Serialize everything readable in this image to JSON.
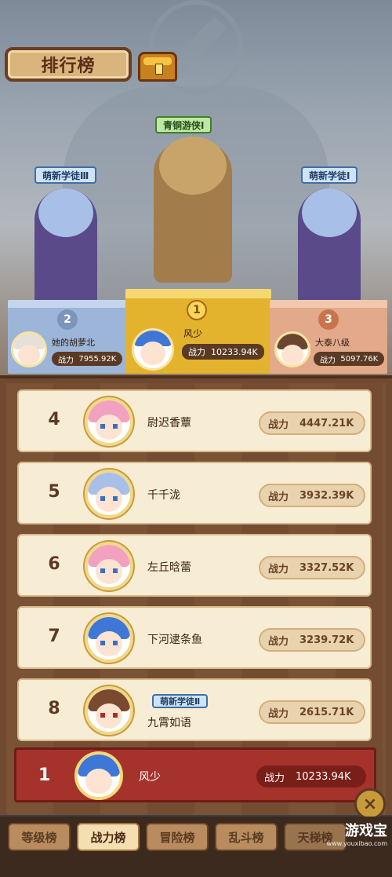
{
  "header": {
    "title": "排行榜"
  },
  "podium": {
    "first": {
      "title": "青铜游侠Ⅰ",
      "rank": "1",
      "name": "风少",
      "power_label": "战力",
      "power": "10233.94K"
    },
    "second": {
      "title": "萌新学徒Ⅲ",
      "rank": "2",
      "name": "她的胡萝北",
      "power_label": "战力",
      "power": "7955.92K"
    },
    "third": {
      "title": "萌新学徒Ⅰ",
      "rank": "3",
      "name": "大泰八级",
      "power_label": "战力",
      "power": "5097.76K"
    }
  },
  "list": [
    {
      "rank": "4",
      "name": "尉迟香蕈",
      "power_label": "战力",
      "power": "4447.21K",
      "hair": "#f2a2c0",
      "badge": ""
    },
    {
      "rank": "5",
      "name": "千千泷",
      "power_label": "战力",
      "power": "3932.39K",
      "hair": "#a8bfe8",
      "badge": ""
    },
    {
      "rank": "6",
      "name": "左丘晗蕾",
      "power_label": "战力",
      "power": "3327.52K",
      "hair": "#f2a2c0",
      "badge": ""
    },
    {
      "rank": "7",
      "name": "下河逮条鱼",
      "power_label": "战力",
      "power": "3239.72K",
      "hair": "#3f77d6",
      "badge": ""
    },
    {
      "rank": "8",
      "name": "九霄如语",
      "power_label": "战力",
      "power": "2615.71K",
      "hair": "#7a4a30",
      "badge": "萌新学徒Ⅱ"
    }
  ],
  "self": {
    "rank": "1",
    "name": "风少",
    "power_label": "战力",
    "power": "10233.94K"
  },
  "close_icon": "×",
  "tabs": [
    {
      "label": "等级榜",
      "active": false
    },
    {
      "label": "战力榜",
      "active": true
    },
    {
      "label": "冒险榜",
      "active": false
    },
    {
      "label": "乱斗榜",
      "active": false
    },
    {
      "label": "天梯榜",
      "active": false
    }
  ],
  "watermark": {
    "main": "游戏宝",
    "sub": "www.youxibao.com"
  },
  "colors": {
    "accent_red": "#a5322b",
    "gold": "#f4c542",
    "row_bg": "#f7ecd4"
  }
}
